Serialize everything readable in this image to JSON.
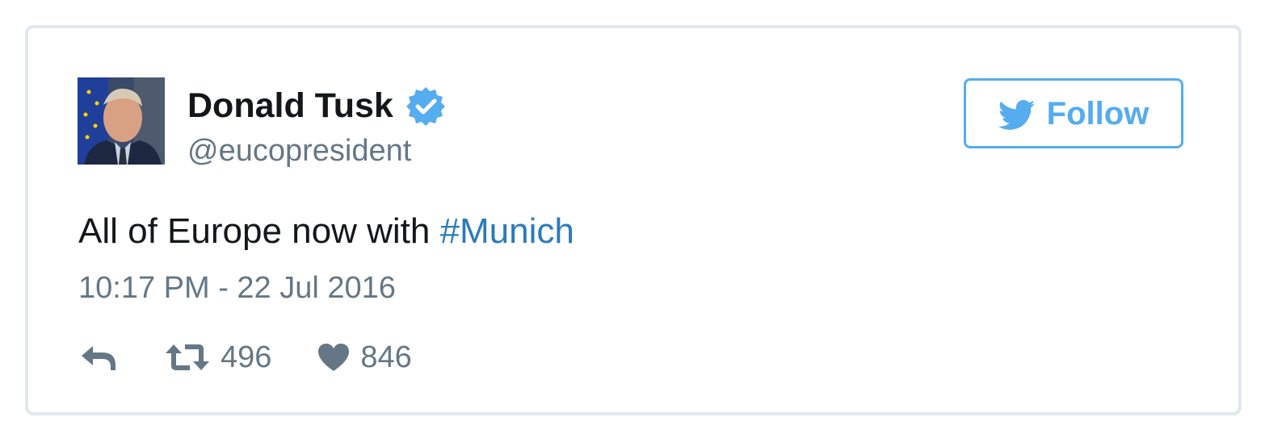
{
  "tweet": {
    "author_name": "Donald Tusk",
    "author_handle": "@eucopresident",
    "verified": true,
    "text_prefix": "All of Europe now with ",
    "hashtag": "#Munich",
    "timestamp": "10:17 PM - 22 Jul 2016",
    "retweet_count": "496",
    "like_count": "846"
  },
  "follow_button": {
    "label": "Follow"
  },
  "icons": {
    "verified": "verified-badge-icon",
    "follow": "twitter-bird-icon",
    "reply": "reply-icon",
    "retweet": "retweet-icon",
    "like": "heart-icon"
  },
  "colors": {
    "brand_blue": "#55acee",
    "link_blue": "#2b7bb9",
    "text_dark": "#14171a",
    "text_muted": "#657786",
    "border": "#e1e8ed"
  }
}
